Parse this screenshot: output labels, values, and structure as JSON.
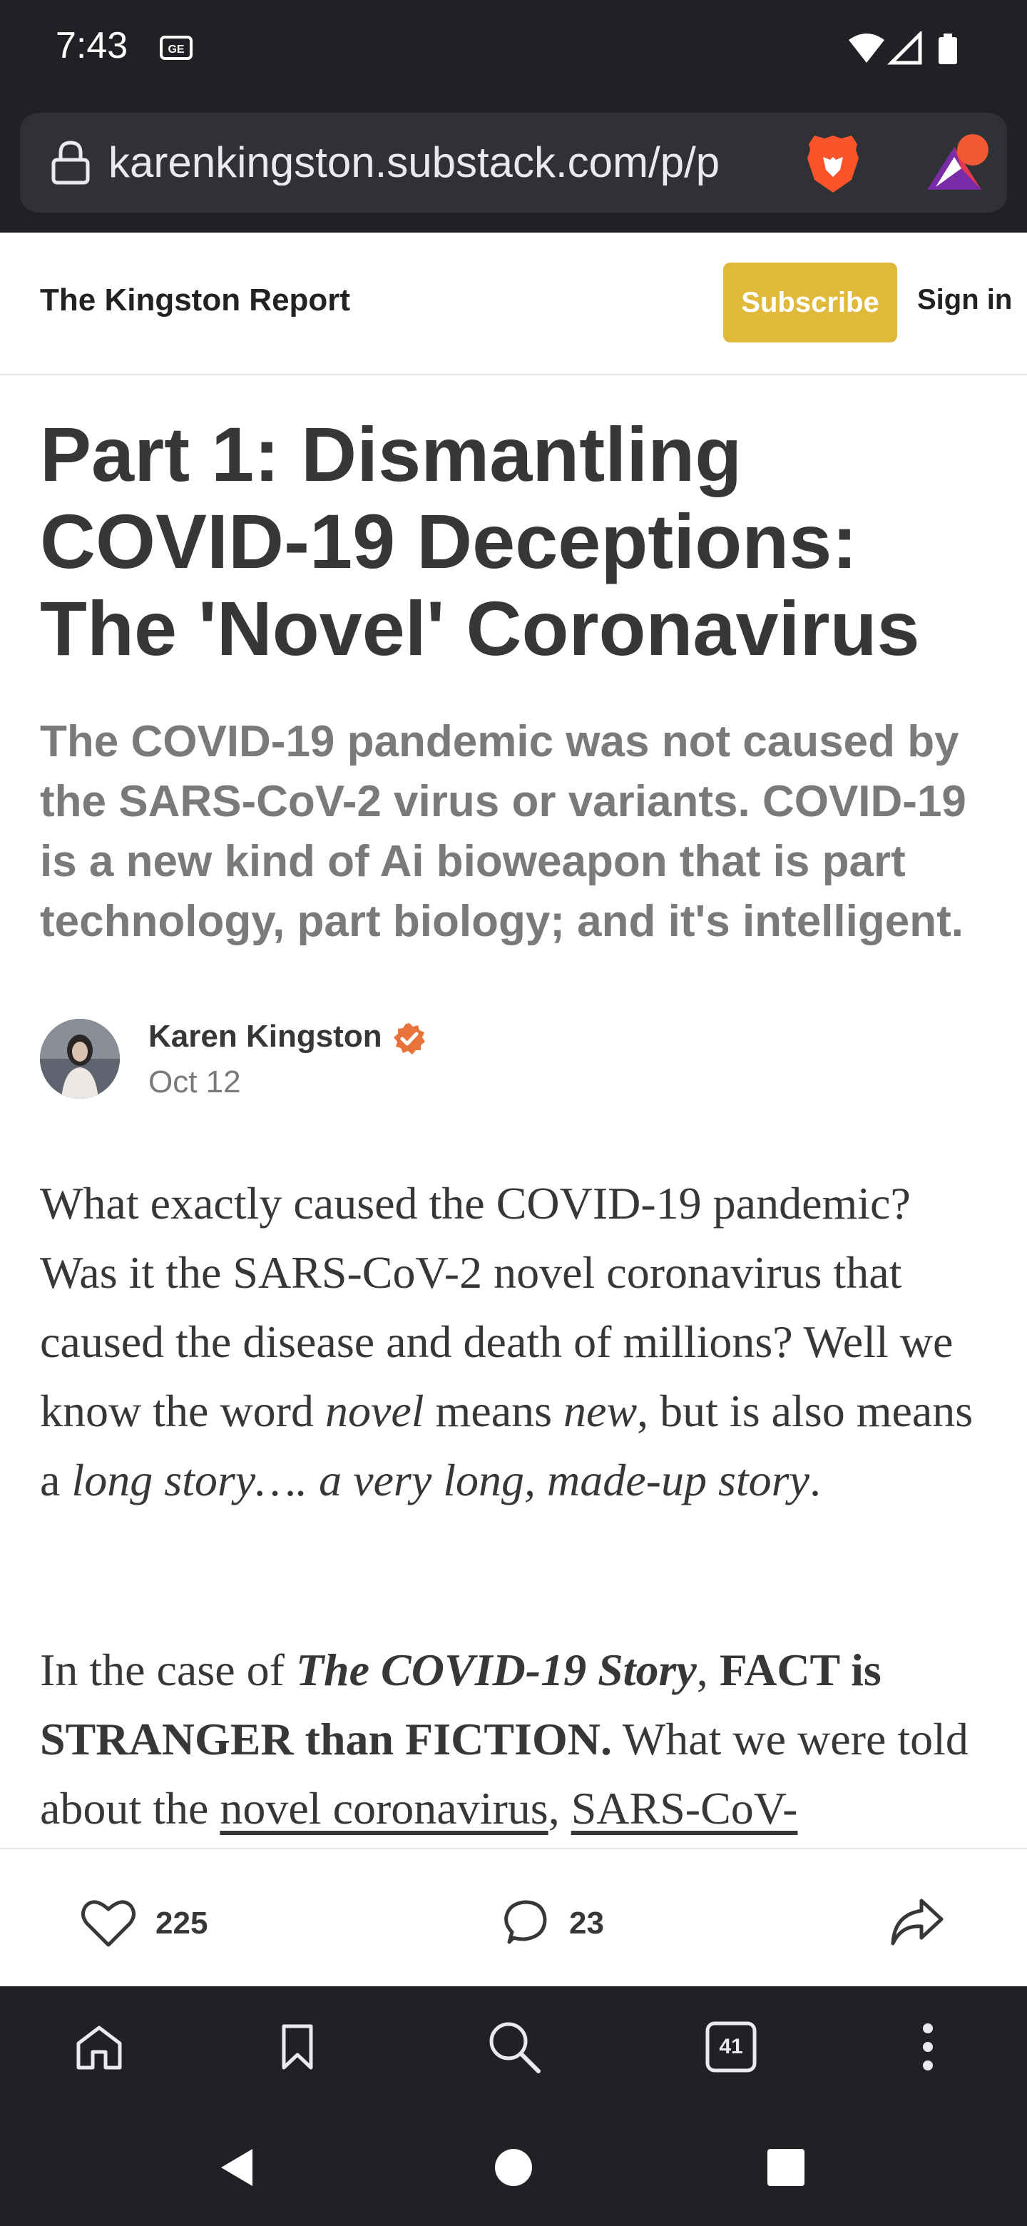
{
  "status_bar": {
    "time": "7:43",
    "icons": [
      "news-notification-icon",
      "wifi-icon",
      "cell-signal-icon",
      "battery-icon"
    ]
  },
  "browser": {
    "url": "karenkingston.substack.com/p/p",
    "icons": [
      "lock-icon",
      "brave-shields-icon",
      "brave-rewards-icon"
    ]
  },
  "publication": {
    "name": "The Kingston Report",
    "subscribe_label": "Subscribe",
    "signin_label": "Sign in",
    "accent_color": "#e0b93b"
  },
  "article": {
    "title": "Part 1: Dismantling COVID-19 Deceptions: The 'Novel' Coronavirus",
    "subtitle": "The COVID-19 pandemic was not caused by the SARS-CoV-2 virus or variants. COVID-19 is a new kind of Ai bioweapon that is part technology, part biology; and it's intelligent.",
    "author": "Karen Kingston",
    "date": "Oct 12",
    "verified_color": "#e8743b",
    "paragraph_1": {
      "text_1": "What exactly caused the COVID-19 pandemic? Was it the SARS-CoV-2 novel coronavirus that caused the disease and death of millions? Well we know the word ",
      "em_1": "novel",
      "text_2": " means ",
      "em_2": "new",
      "text_3": ", but is also means a ",
      "em_3": "long story…. a very long, made-up story",
      "text_4": "."
    },
    "paragraph_2": {
      "text_1": "In the case of ",
      "strong_em": "The COVID-19 Story",
      "text_2": ", ",
      "strong": "FACT is STRANGER than FICTION.",
      "text_3": " What we were told about the ",
      "link_1": "novel coronavirus",
      "text_4": ", ",
      "link_2": "SARS-CoV-"
    }
  },
  "engagement": {
    "likes": "225",
    "comments": "23",
    "icons": [
      "heart-icon",
      "comment-icon",
      "share-icon"
    ]
  },
  "toolbar": {
    "tab_count": "41",
    "icons": [
      "home-icon",
      "bookmark-icon",
      "search-icon",
      "tabs-icon",
      "more-icon"
    ]
  },
  "nav": {
    "icons": [
      "back-icon",
      "home-circle-icon",
      "recents-icon"
    ]
  }
}
